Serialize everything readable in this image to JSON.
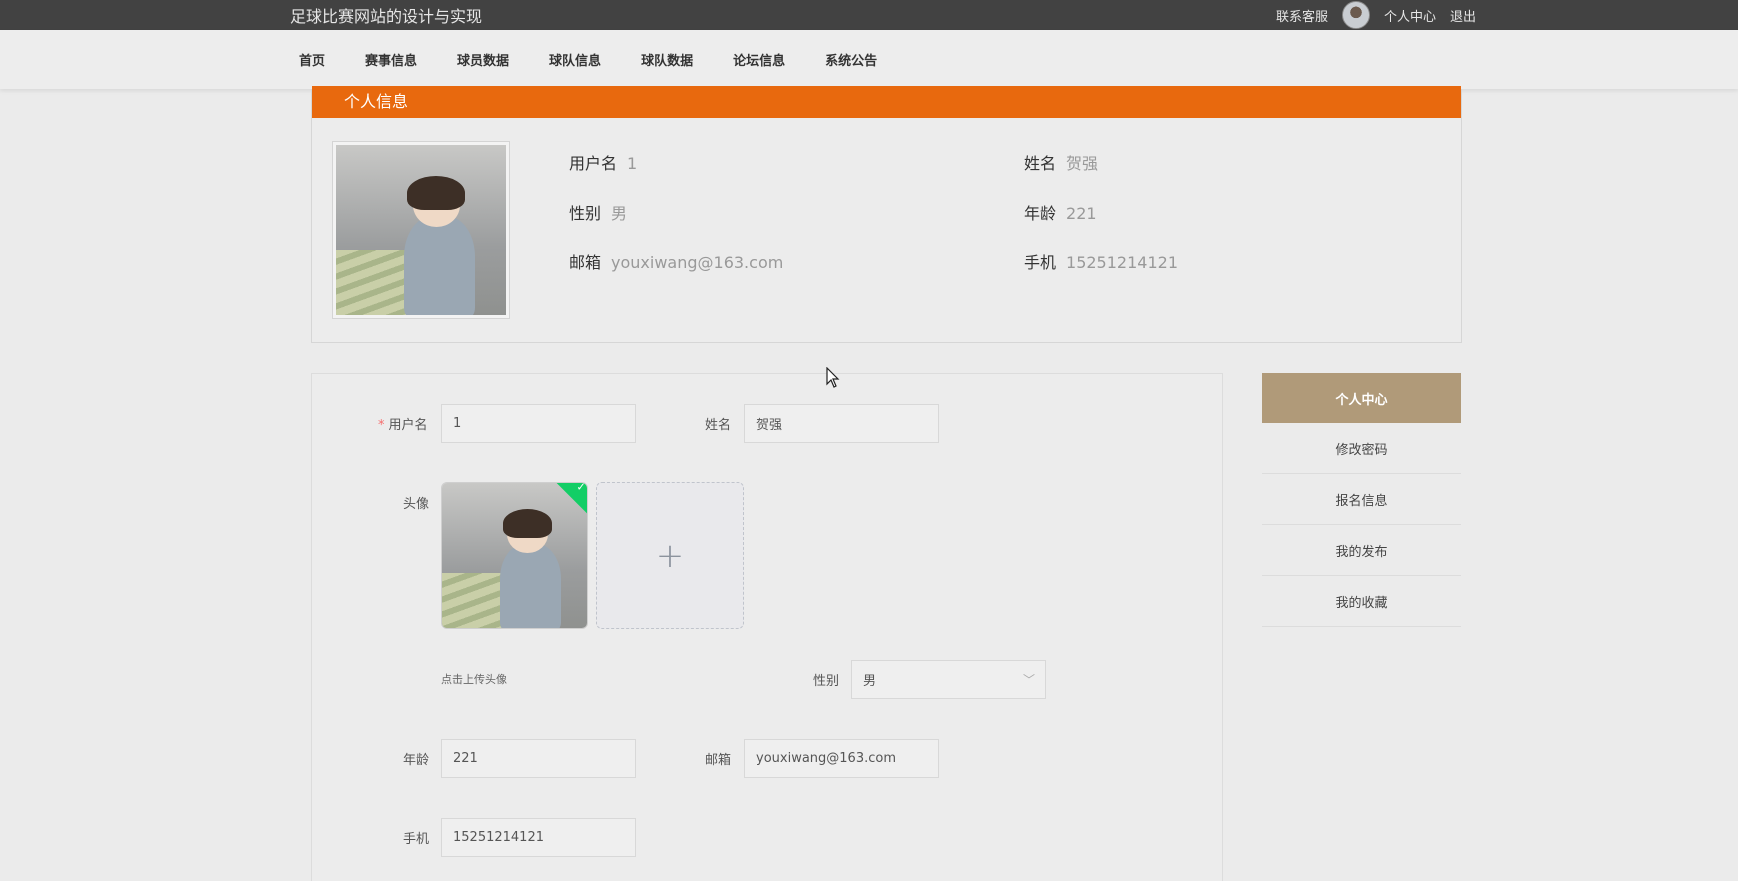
{
  "header": {
    "site_title": "足球比赛网站的设计与实现",
    "contact": "联系客服",
    "user_center": "个人中心",
    "logout": "退出"
  },
  "nav": {
    "items": [
      "首页",
      "赛事信息",
      "球员数据",
      "球队信息",
      "球队数据",
      "论坛信息",
      "系统公告"
    ]
  },
  "profile": {
    "section_title": "个人信息",
    "username_label": "用户名",
    "username": "1",
    "name_label": "姓名",
    "name": "贺强",
    "gender_label": "性别",
    "gender": "男",
    "age_label": "年龄",
    "age": "221",
    "email_label": "邮箱",
    "email": "youxiwang@163.com",
    "phone_label": "手机",
    "phone": "15251214121"
  },
  "form": {
    "username_label": "用户名",
    "username_value": "1",
    "name_label": "姓名",
    "name_value": "贺强",
    "avatar_label": "头像",
    "upload_plus": "+",
    "upload_hint": "点击上传头像",
    "gender_label": "性别",
    "gender_value": "男",
    "age_label": "年龄",
    "age_value": "221",
    "email_label": "邮箱",
    "email_value": "youxiwang@163.com",
    "phone_label": "手机",
    "phone_value": "15251214121",
    "required_mark": "*",
    "check_mark": "✓",
    "select_arrow": "﹀"
  },
  "side_menu": {
    "items": [
      "个人中心",
      "修改密码",
      "报名信息",
      "我的发布",
      "我的收藏"
    ]
  },
  "colors": {
    "accent_orange": "#e8690e",
    "menu_active": "#b09a79",
    "topbar": "#424242",
    "success_green": "#13ce66"
  }
}
